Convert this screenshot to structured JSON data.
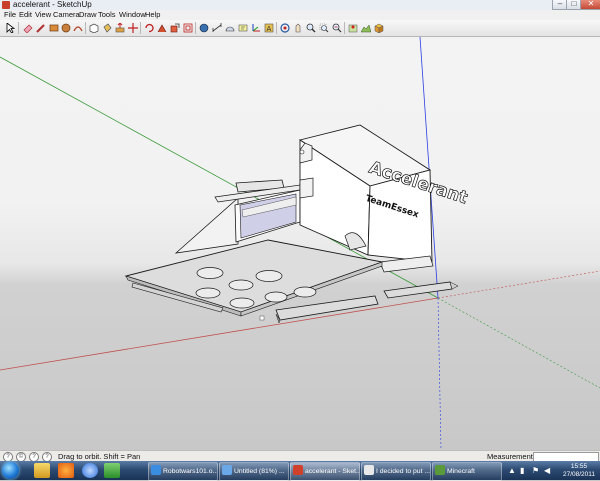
{
  "window": {
    "title": "accelerant - SketchUp",
    "controls": {
      "minimize": "–",
      "maximize": "□",
      "close": "✕"
    }
  },
  "menu": [
    "File",
    "Edit",
    "View",
    "Camera",
    "Draw",
    "Tools",
    "Window",
    "Help"
  ],
  "toolbar": {
    "icons": [
      "select-icon",
      "eraser-icon",
      "pencil-line-icon",
      "rectangle-icon",
      "circle-icon",
      "arc-icon",
      "make-component-icon",
      "paint-bucket-icon",
      "push-pull-icon",
      "move-icon",
      "rotate-icon",
      "follow-me-icon",
      "scale-icon",
      "offset-icon",
      "tape-measure-icon",
      "dimension-icon",
      "protractor-icon",
      "text-icon",
      "axes-icon",
      "3d-text-icon",
      "orbit-icon",
      "pan-icon",
      "zoom-icon",
      "zoom-window-icon",
      "zoom-extents-icon",
      "add-location-icon",
      "toggle-terrain-icon",
      "get-models-icon",
      "share-model-icon",
      "share-component-icon",
      "preview-google-earth-icon",
      "components-window-icon",
      "materials-icon"
    ]
  },
  "model": {
    "logo_text": "Accelerant",
    "logo_sub": "TeamEssex"
  },
  "status": {
    "hint": "Drag to orbit.  Shift = Pan",
    "measurements_label": "Measurements",
    "measurements_value": ""
  },
  "taskbar": {
    "pinned": [
      "explorer-icon",
      "media-player-icon",
      "itunes-icon",
      "windows-live-icon"
    ],
    "items": [
      {
        "label": "Robotwars101.o...",
        "icon": "internet-explorer-icon"
      },
      {
        "label": "Untitled (81%) ...",
        "icon": "paint-icon"
      },
      {
        "label": "accelerant - Sket...",
        "icon": "sketchup-icon"
      },
      {
        "label": "I decided to put ...",
        "icon": "notepad-icon"
      },
      {
        "label": "Minecraft",
        "icon": "minecraft-icon"
      }
    ],
    "clock": {
      "time": "15:55",
      "date": "27/08/2011"
    }
  },
  "colors": {
    "axis_red": "#c0504d",
    "axis_green": "#3d9a3d",
    "axis_blue": "#2b3ee0",
    "model_face": "#f4f4f4",
    "model_edge": "#1a1a1a",
    "plate_gray": "#dddddd"
  }
}
